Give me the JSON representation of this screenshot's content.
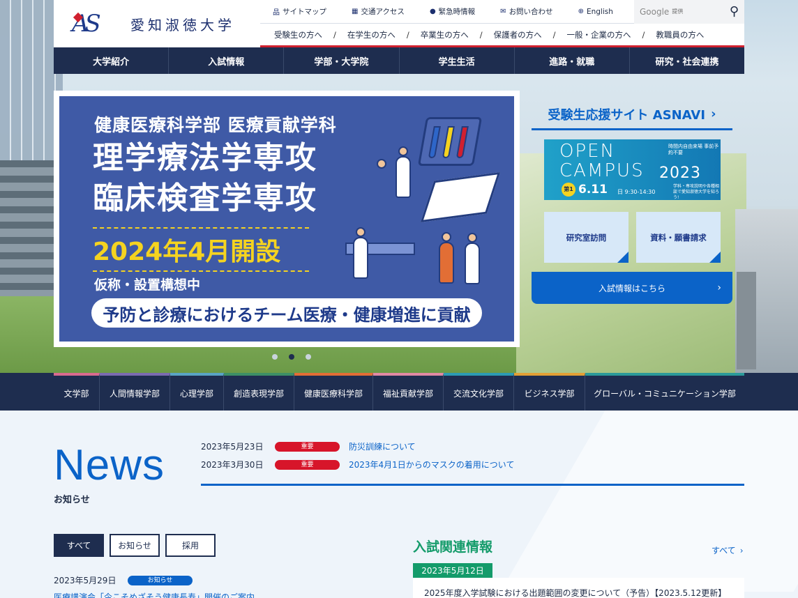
{
  "logo": {
    "mark": "AS",
    "name": "愛知淑徳大学"
  },
  "utility_nav": {
    "items": [
      {
        "icon": "sitemap-icon",
        "glyph": "品",
        "label": "サイトマップ"
      },
      {
        "icon": "building-icon",
        "glyph": "▦",
        "label": "交通アクセス"
      },
      {
        "icon": "alert-icon",
        "glyph": "●",
        "label": "緊急時情報"
      },
      {
        "icon": "mail-icon",
        "glyph": "✉",
        "label": "お問い合わせ"
      },
      {
        "icon": "globe-icon",
        "glyph": "⊕",
        "label": "English"
      }
    ],
    "search": {
      "brand": "Google",
      "suffix": "提供"
    }
  },
  "audience_nav": [
    "受験生の方へ",
    "在学生の方へ",
    "卒業生の方へ",
    "保護者の方へ",
    "一般・企業の方へ",
    "教職員の方へ"
  ],
  "global_nav": [
    "大学紹介",
    "入試情報",
    "学部・大学院",
    "学生生活",
    "進路・就職",
    "研究・社会連携"
  ],
  "hero_slide": {
    "line1": "健康医療科学部 医療貢献学科",
    "line2": "理学療法学専攻",
    "line3": "臨床検査学専攻",
    "line4": "2024年4月開設",
    "line5": "仮称・設置構想中",
    "line6": "予防と診療におけるチーム医療・健康増進に貢献"
  },
  "side": {
    "asnavi": "受験生応援サイト ASNAVI",
    "open_campus": {
      "t1": "OPEN",
      "t2": "CAMPUS",
      "year": "2023",
      "note": "時間内自由来場 事前予約不要",
      "badge": "第1回",
      "date": "6.11",
      "day": "日",
      "time": "9:30-14:30",
      "sub": "学科・専攻説明や各種相談で愛知淑徳大学を知ろう!"
    },
    "btn_lab": "研究室訪問",
    "btn_docs": "資料・願書請求",
    "exam_btn": "入試情報はこちら"
  },
  "faculty_nav": [
    {
      "label": "文学部",
      "color": "#d86b8e"
    },
    {
      "label": "人間情報学部",
      "color": "#7b6bb0"
    },
    {
      "label": "心理学部",
      "color": "#59a4c4"
    },
    {
      "label": "創造表現学部",
      "color": "#3d8f66"
    },
    {
      "label": "健康医療科学部",
      "color": "#e26e35"
    },
    {
      "label": "福祉貢献学部",
      "color": "#e08aa3"
    },
    {
      "label": "交流文化学部",
      "color": "#2c9bb3"
    },
    {
      "label": "ビジネス学部",
      "color": "#e2a035"
    },
    {
      "label": "グローバル・コミュニケーション学部",
      "color": "#2b9a9a"
    }
  ],
  "news": {
    "title": "News",
    "subtitle": "お知らせ",
    "important": [
      {
        "date": "2023年5月23日",
        "tag": "重要",
        "title": "防災訓練について"
      },
      {
        "date": "2023年3月30日",
        "tag": "重要",
        "title": "2023年4月1日からのマスクの着用について"
      }
    ],
    "tabs": [
      "すべて",
      "お知らせ",
      "採用"
    ],
    "items": [
      {
        "date": "2023年5月29日",
        "tag": "お知らせ",
        "title": "医療講演会「今こそめざそう健康長寿」開催のご案内"
      }
    ]
  },
  "exam_news": {
    "title": "入試関連情報",
    "all": "すべて",
    "items": [
      {
        "date": "2023年5月12日",
        "title": "2025年度入学試験における出題範囲の変更について（予告）【2023.5.12更新】"
      }
    ]
  },
  "slider": {
    "count": 3,
    "active": 2
  }
}
